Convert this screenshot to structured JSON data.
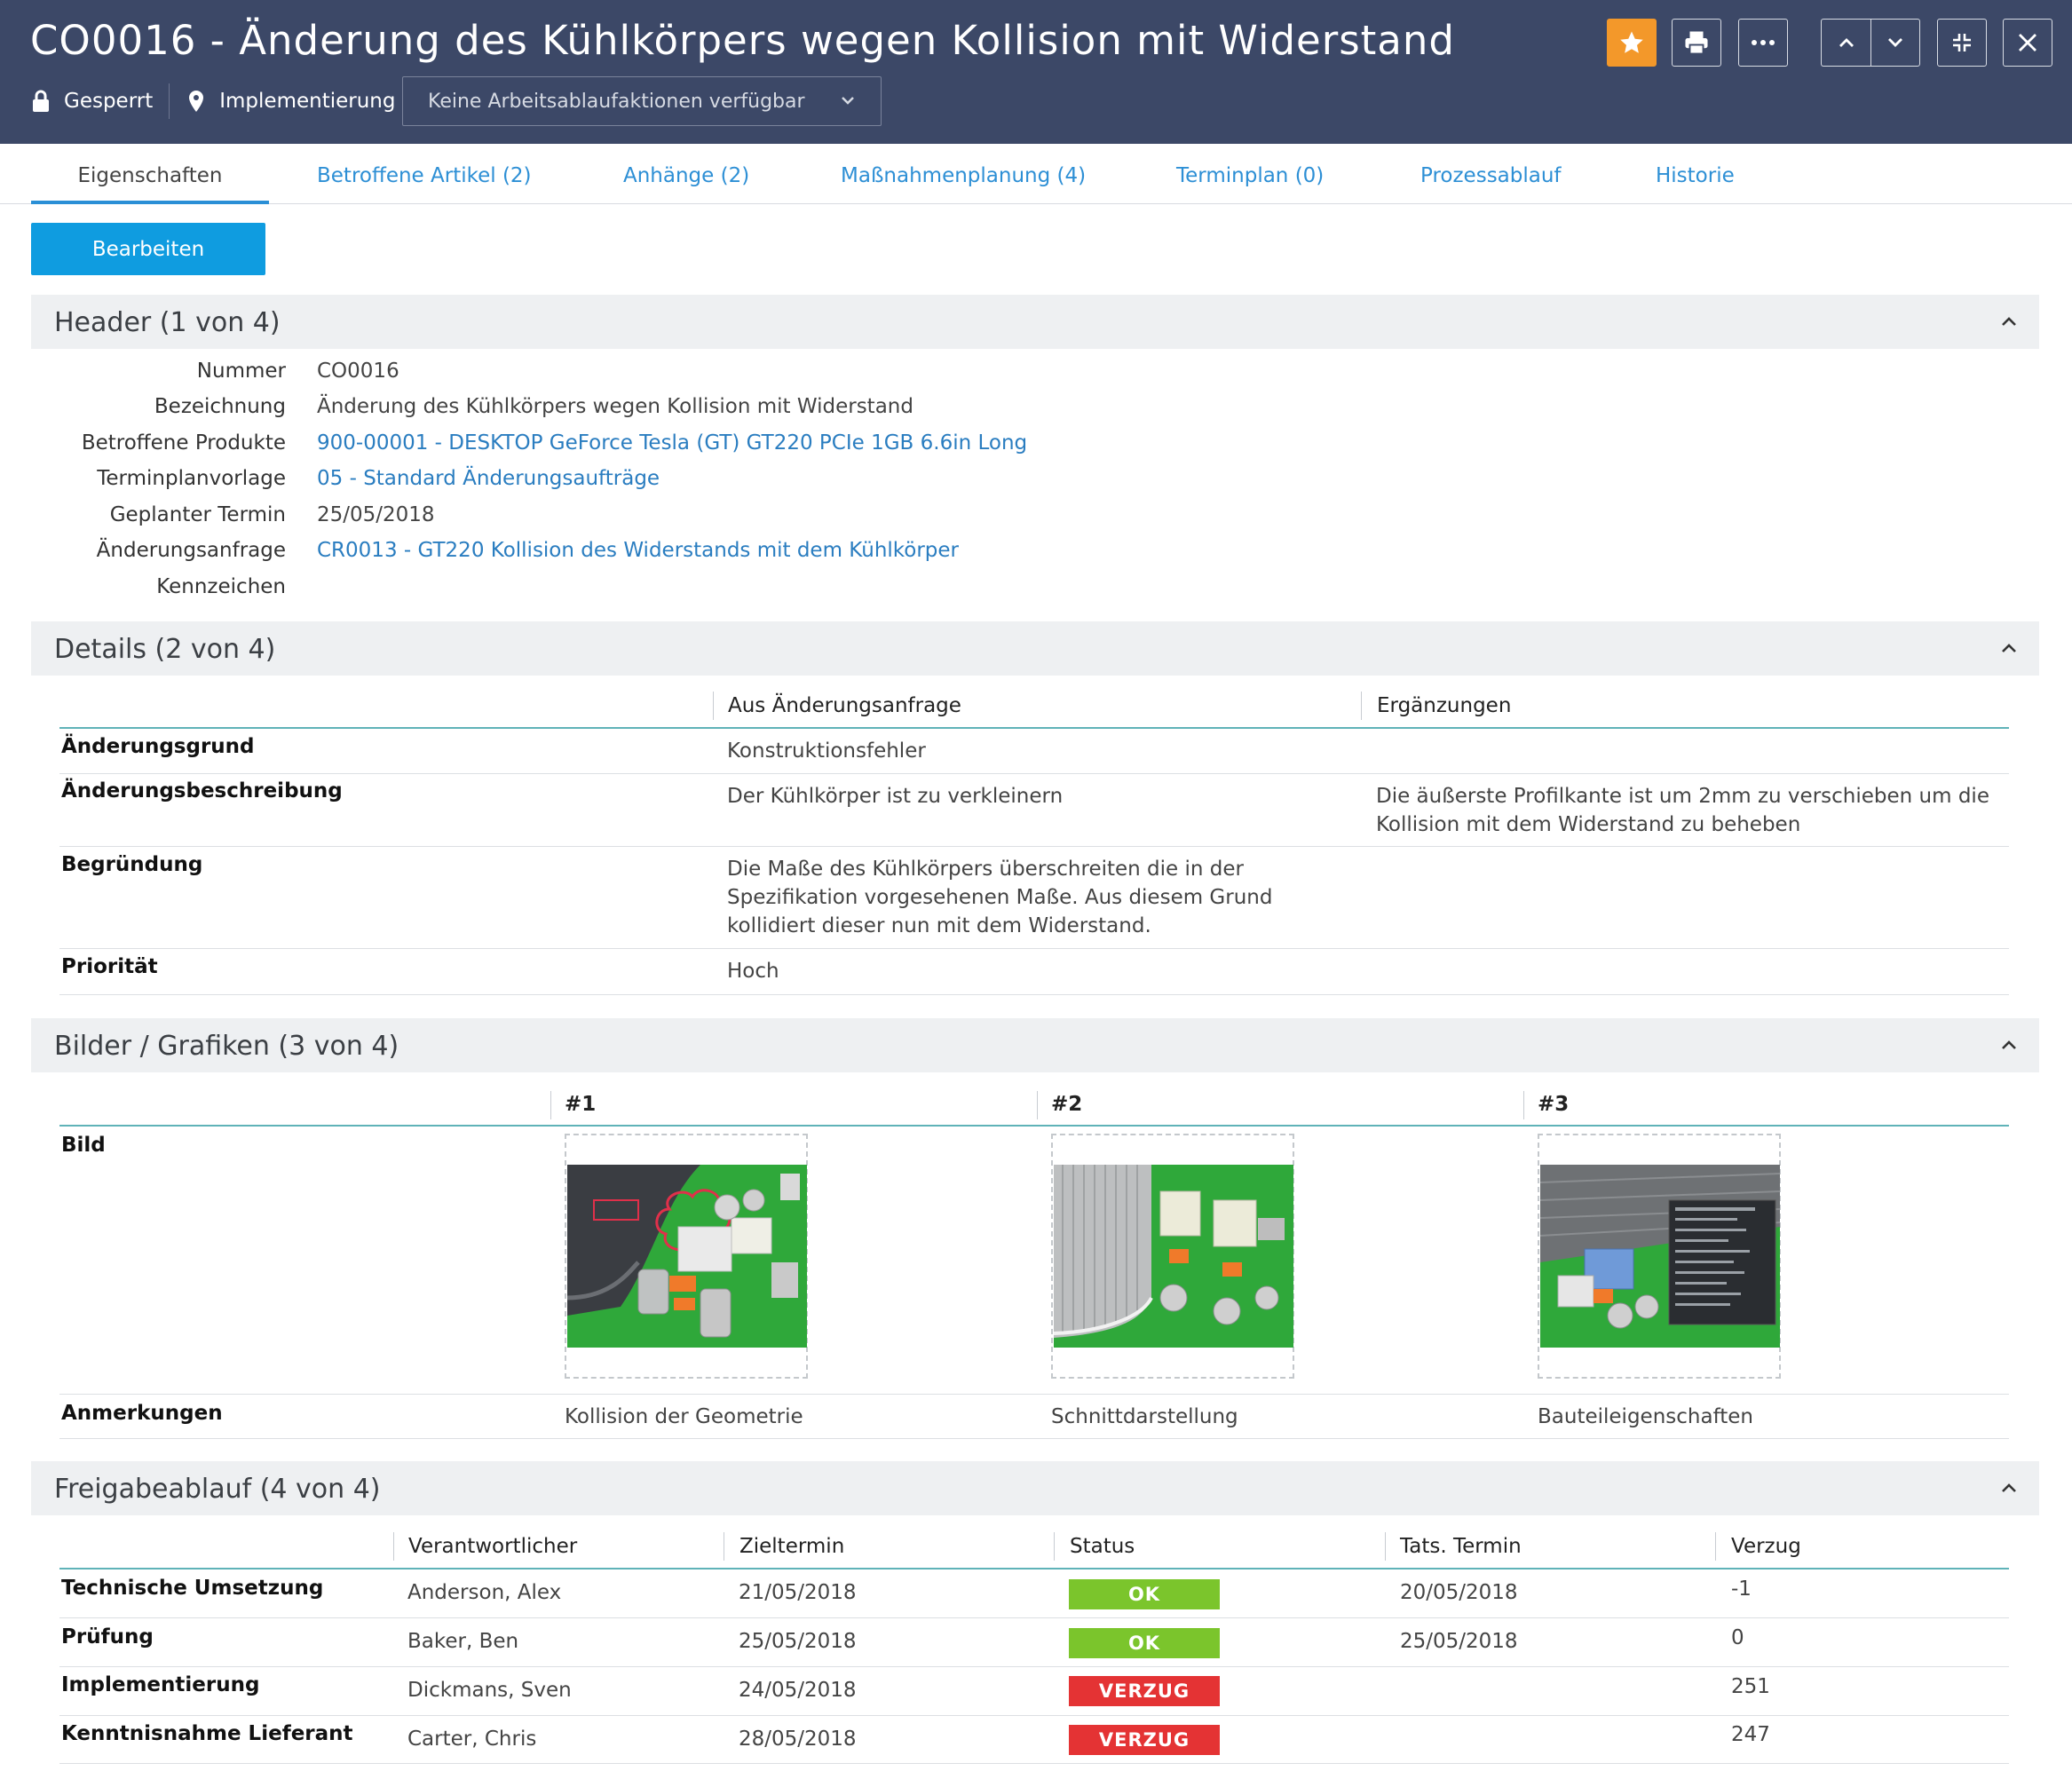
{
  "window": {
    "title": "CO0016 - Änderung des Kühlkörpers wegen Kollision mit Widerstand",
    "lock_label": "Gesperrt",
    "location_label": "Implementierung",
    "workflow_select": "Keine Arbeitsablaufaktionen verfügbar",
    "toolbar_icons": [
      "star-icon",
      "printer-icon",
      "more-icon",
      "chevron-up-icon",
      "chevron-down-icon",
      "collapse-icon",
      "close-icon"
    ],
    "accent_color": "#f3982a",
    "header_color": "#3c4867"
  },
  "tabs": [
    {
      "label": "Eigenschaften",
      "active": true
    },
    {
      "label": "Betroffene Artikel (2)"
    },
    {
      "label": "Anhänge (2)"
    },
    {
      "label": "Maßnahmenplanung (4)"
    },
    {
      "label": "Terminplan (0)"
    },
    {
      "label": "Prozessablauf"
    },
    {
      "label": "Historie"
    }
  ],
  "edit_button": "Bearbeiten",
  "sections": {
    "header": {
      "title": "Header (1 von 4)",
      "fields": [
        {
          "label": "Nummer",
          "value": "CO0016"
        },
        {
          "label": "Bezeichnung",
          "value": "Änderung des Kühlkörpers wegen Kollision mit Widerstand"
        },
        {
          "label": "Betroffene Produkte",
          "value": "900-00001 - DESKTOP GeForce Tesla (GT) GT220 PCIe 1GB 6.6in Long"
        },
        {
          "label": "Terminplanvorlage",
          "value": "05 - Standard Änderungsaufträge"
        },
        {
          "label": "Geplanter Termin",
          "value": "25/05/2018"
        },
        {
          "label": "Änderungsanfrage",
          "value": "CR0013 - GT220 Kollision des Widerstands mit dem Kühlkörper"
        },
        {
          "label": "Kennzeichen",
          "value": ""
        }
      ]
    },
    "details": {
      "title": "Details (2 von 4)",
      "columns": [
        "Aus Änderungsanfrage",
        "Ergänzungen"
      ],
      "rows": [
        {
          "label": "Änderungsgrund",
          "from_request": "Konstruktionsfehler",
          "additions": ""
        },
        {
          "label": "Änderungsbeschreibung",
          "from_request": "Der Kühlkörper ist zu verkleinern",
          "additions": "Die äußerste Profilkante ist um 2mm zu verschieben um die Kollision mit dem Widerstand zu beheben"
        },
        {
          "label": "Begründung",
          "from_request": "Die Maße des Kühlkörpers überschreiten die in der Spezifikation vorgesehenen Maße. Aus diesem Grund kollidiert dieser nun mit dem Widerstand.",
          "additions": ""
        },
        {
          "label": "Priorität",
          "from_request": "Hoch",
          "additions": ""
        }
      ]
    },
    "images": {
      "title": "Bilder / Grafiken (3 von 4)",
      "columns": [
        "#1",
        "#2",
        "#3"
      ],
      "row_image_label": "Bild",
      "row_notes_label": "Anmerkungen",
      "notes": [
        "Kollision der Geometrie",
        "Schnittdarstellung",
        "Bauteileigenschaften"
      ]
    },
    "approval": {
      "title": "Freigabeablauf (4 von 4)",
      "columns": [
        "Verantwortlicher",
        "Zieltermin",
        "Status",
        "Tats. Termin",
        "Verzug"
      ],
      "rows": [
        {
          "step": "Technische Umsetzung",
          "owner": "Anderson, Alex",
          "target": "21/05/2018",
          "status": "OK",
          "actual": "20/05/2018",
          "delay": "-1"
        },
        {
          "step": "Prüfung",
          "owner": "Baker, Ben",
          "target": "25/05/2018",
          "status": "OK",
          "actual": "25/05/2018",
          "delay": "0"
        },
        {
          "step": "Implementierung",
          "owner": "Dickmans, Sven",
          "target": "24/05/2018",
          "status": "VERZUG",
          "actual": "",
          "delay": "251"
        },
        {
          "step": "Kenntnisnahme Lieferant",
          "owner": "Carter, Chris",
          "target": "28/05/2018",
          "status": "VERZUG",
          "actual": "",
          "delay": "247"
        }
      ],
      "status_colors": {
        "OK": "#7bc52c",
        "VERZUG": "#e43334"
      }
    }
  }
}
